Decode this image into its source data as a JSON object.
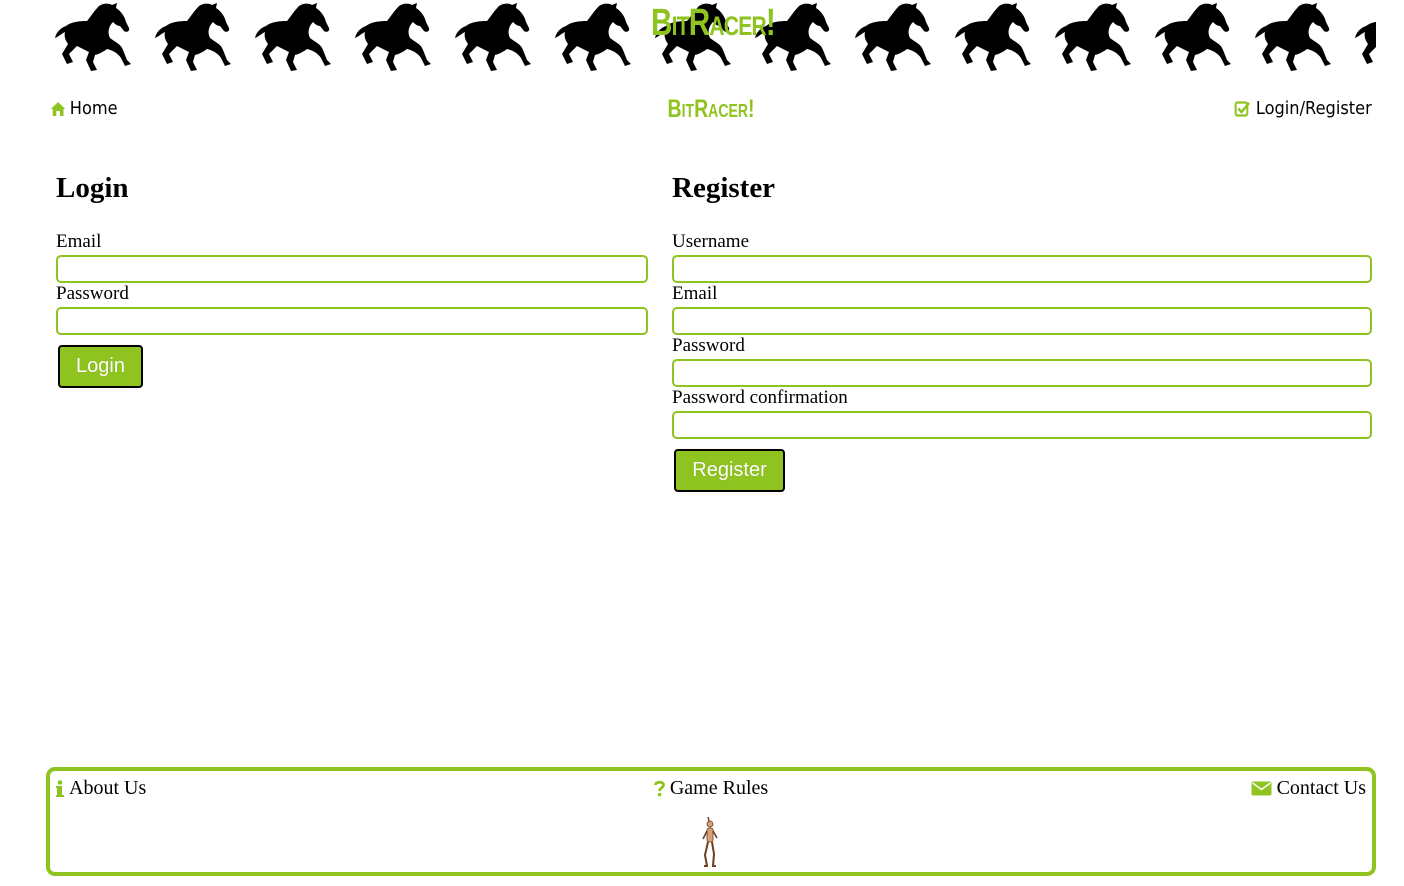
{
  "banner": {
    "title": "BitRacer!",
    "horse_icon": "galloping-horse-icon",
    "horse_count": 14
  },
  "nav": {
    "home_label": "Home",
    "home_icon": "home-icon",
    "brand": "BitRacer!",
    "login_label": "Login/Register",
    "login_icon": "check-square-icon"
  },
  "login": {
    "heading": "Login",
    "email_label": "Email",
    "email_value": "",
    "password_label": "Password",
    "password_value": "",
    "button": "Login"
  },
  "register": {
    "heading": "Register",
    "username_label": "Username",
    "username_value": "",
    "email_label": "Email",
    "email_value": "",
    "password_label": "Password",
    "password_value": "",
    "confirm_label": "Password confirmation",
    "confirm_value": "",
    "button": "Register"
  },
  "footer": {
    "about_label": "About Us",
    "about_icon": "info-icon",
    "rules_label": "Game Rules",
    "rules_icon": "question-icon",
    "contact_label": "Contact Us",
    "contact_icon": "envelope-icon",
    "figure_icon": "dancing-figure-icon"
  },
  "colors": {
    "accent": "#8fc31f",
    "text": "#000000",
    "background": "#ffffff"
  }
}
